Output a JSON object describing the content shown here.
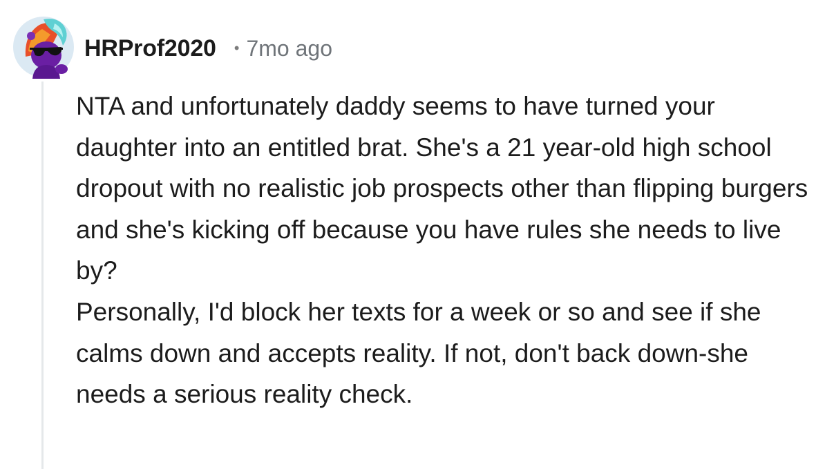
{
  "comment": {
    "author": "HRProf2020",
    "separator": "•",
    "time_ago": "7mo ago",
    "paragraphs": [
      "NTA and unfortunately daddy seems to have turned your daughter into an entitled brat. She's a 21 year-old high school dropout with no realistic job prospects other than flipping burgers and she's kicking off because you have rules she needs to live by?",
      "Personally, I'd block her texts for a week or so and see if she calms down and accepts reality. If not, don't back down-she needs a serious reality check."
    ],
    "avatar_icon": "snoo-avatar-icon"
  },
  "colors": {
    "author": "#1c1c1c",
    "meta": "#6f7479",
    "body_text": "#1c1c1c",
    "thread_line": "#e5e8ea",
    "avatar_bg": "#dbe9f3",
    "avatar_skin": "#6a1fa3",
    "avatar_hair_orange": "#f07d28",
    "avatar_hair_teal": "#5fd0d3"
  }
}
